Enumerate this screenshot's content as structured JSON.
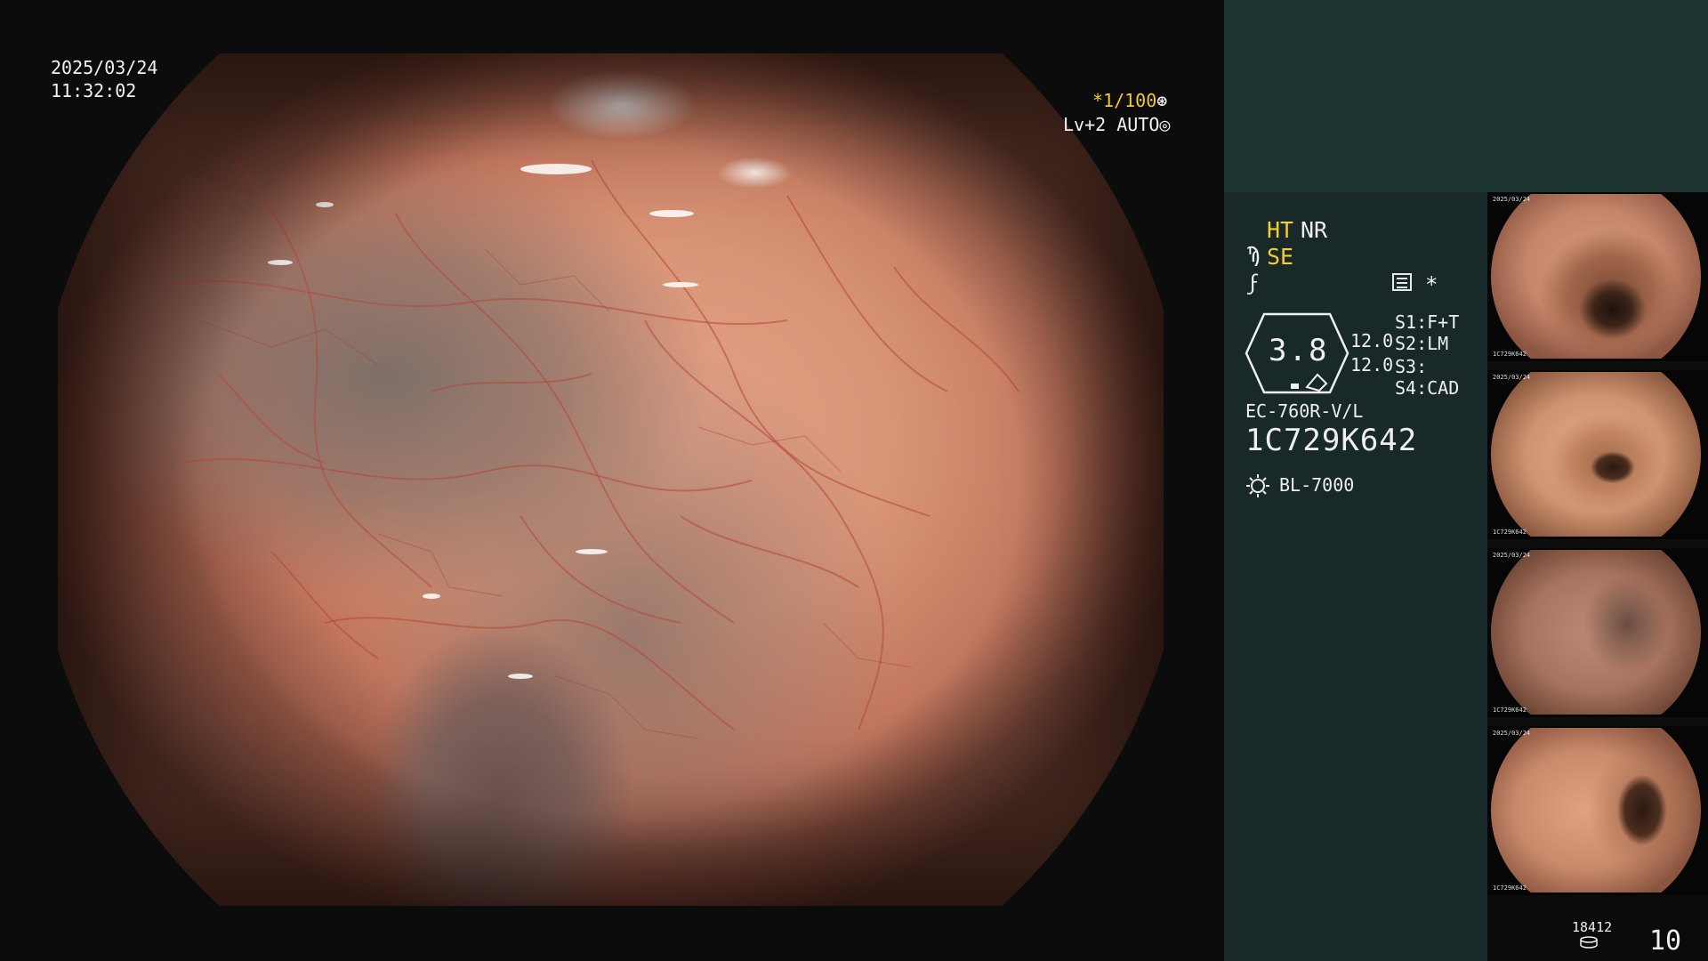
{
  "overlay": {
    "date": "2025/03/24",
    "time": "11:32:02",
    "shutter": "*1/100",
    "shutter_icon": "⊛",
    "level": "Lv+2 AUTO",
    "level_icon": "◎"
  },
  "panel": {
    "ht": "HT",
    "nr": "NR",
    "se_icon": "Ϡ",
    "se": "SE",
    "enhance_icon": "ϝ",
    "star": "*",
    "hex_value": "3.8",
    "value_a": "12.0",
    "value_b": "12.0",
    "s1": "S1:F+T",
    "s2": "S2:LM",
    "s3": "S3:",
    "s4": "S4:CAD",
    "model": "EC-760R-V/L",
    "serial": "1C729K642",
    "light_source": "BL-7000",
    "counter": "18412",
    "page": "10"
  },
  "thumbnails": [
    {
      "caption_top": "2025/03/24",
      "caption_bottom": "1C729K642"
    },
    {
      "caption_top": "2025/03/24",
      "caption_bottom": "1C729K642"
    },
    {
      "caption_top": "2025/03/24",
      "caption_bottom": "1C729K642"
    },
    {
      "caption_top": "2025/03/24",
      "caption_bottom": "1C729K642"
    }
  ],
  "colors": {
    "accent_yellow": "#f5cd2e",
    "panel_bg": "#19292a",
    "top_panel_bg": "#1d3531"
  }
}
